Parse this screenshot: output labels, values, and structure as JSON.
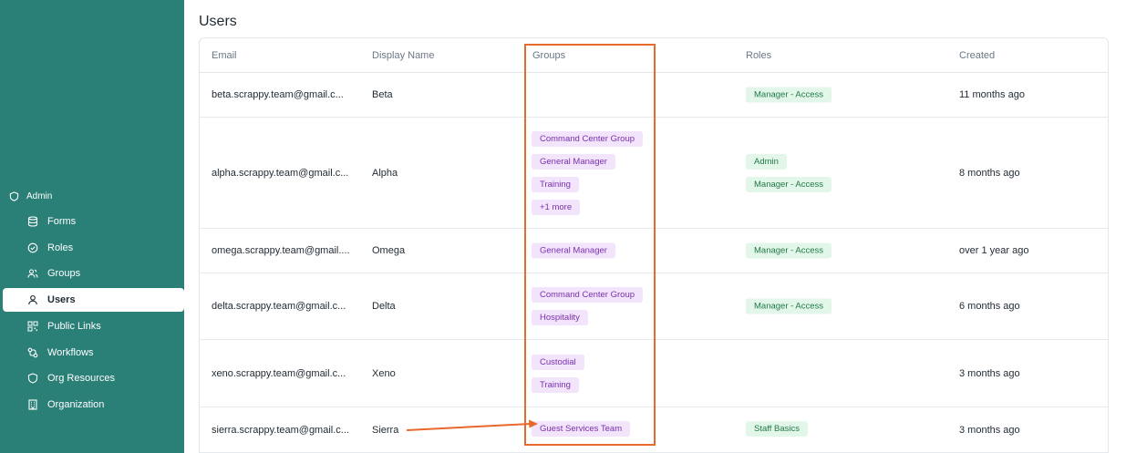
{
  "sidebar": {
    "section_label": "Admin",
    "items": [
      {
        "label": "Forms",
        "icon": "database-icon"
      },
      {
        "label": "Roles",
        "icon": "check-circle-icon"
      },
      {
        "label": "Groups",
        "icon": "users-icon"
      },
      {
        "label": "Users",
        "icon": "user-icon",
        "active": true
      },
      {
        "label": "Public Links",
        "icon": "qr-code-icon"
      },
      {
        "label": "Workflows",
        "icon": "workflow-icon"
      },
      {
        "label": "Org Resources",
        "icon": "shield-icon"
      },
      {
        "label": "Organization",
        "icon": "building-icon"
      }
    ],
    "bg_color": "#2a7f77"
  },
  "main": {
    "title": "Users",
    "columns": [
      "Email",
      "Display Name",
      "Groups",
      "Roles",
      "Created"
    ],
    "rows": [
      {
        "email": "beta.scrappy.team@gmail.c...",
        "display_name": "Beta",
        "groups": [],
        "roles": [
          "Manager - Access"
        ],
        "created": "11 months ago"
      },
      {
        "email": "alpha.scrappy.team@gmail.c...",
        "display_name": "Alpha",
        "groups": [
          "Command Center Group",
          "General Manager",
          "Training",
          "+1 more"
        ],
        "roles": [
          "Admin",
          "Manager - Access"
        ],
        "created": "8 months ago"
      },
      {
        "email": "omega.scrappy.team@gmail....",
        "display_name": "Omega",
        "groups": [
          "General Manager"
        ],
        "roles": [
          "Manager - Access"
        ],
        "created": "over 1 year ago"
      },
      {
        "email": "delta.scrappy.team@gmail.c...",
        "display_name": "Delta",
        "groups": [
          "Command Center Group",
          "Hospitality"
        ],
        "roles": [
          "Manager - Access"
        ],
        "created": "6 months ago"
      },
      {
        "email": "xeno.scrappy.team@gmail.c...",
        "display_name": "Xeno",
        "groups": [
          "Custodial",
          "Training"
        ],
        "roles": [],
        "created": "3 months ago"
      },
      {
        "email": "sierra.scrappy.team@gmail.c...",
        "display_name": "Sierra",
        "groups": [
          "Guest Services Team"
        ],
        "roles": [
          "Staff Basics"
        ],
        "created": "3 months ago"
      }
    ]
  },
  "colors": {
    "group_badge_bg": "#f2e4fb",
    "group_badge_text": "#7a2fb0",
    "role_badge_bg": "#e3f6ea",
    "role_badge_text": "#1f7a43",
    "annotation": "#e8692c"
  }
}
